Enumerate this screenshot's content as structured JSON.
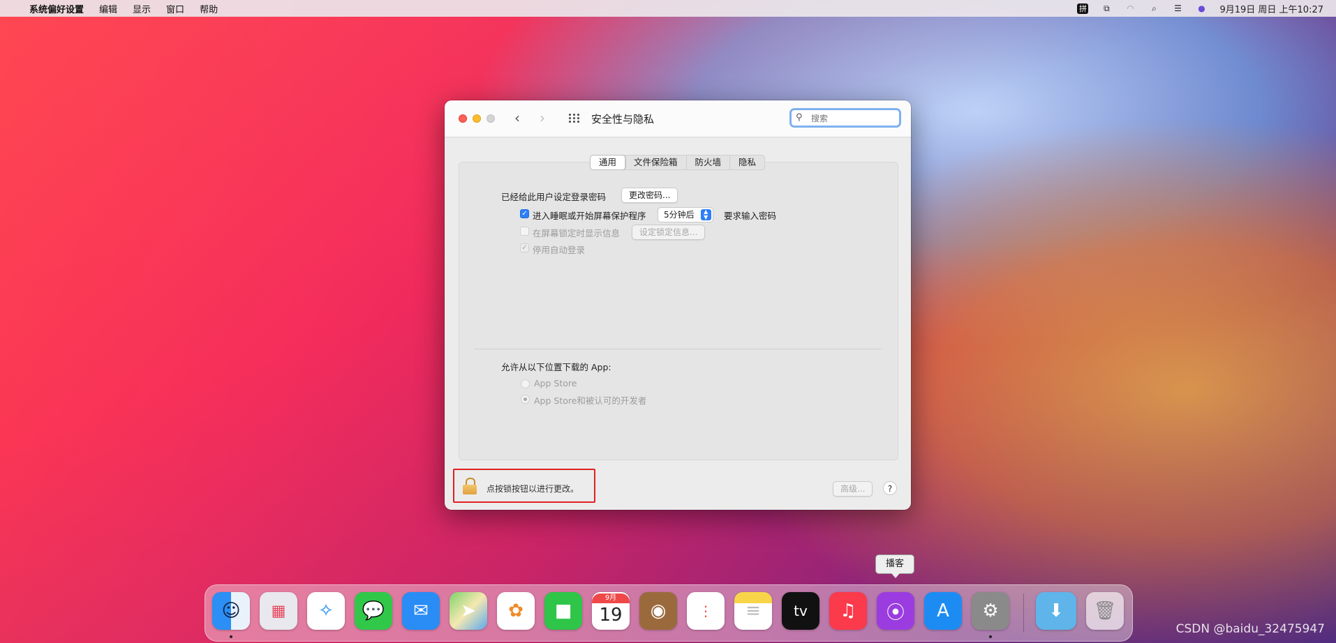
{
  "menubar": {
    "app": "系统偏好设置",
    "items": [
      "编辑",
      "显示",
      "窗口",
      "帮助"
    ],
    "ime": "拼",
    "datetime": "9月19日 周日 上午10:27"
  },
  "window": {
    "title": "安全性与隐私",
    "search_placeholder": "搜索",
    "tabs": [
      "通用",
      "文件保险箱",
      "防火墙",
      "隐私"
    ],
    "general": {
      "password_label": "已经给此用户设定登录密码",
      "change_password_btn": "更改密码...",
      "sleep_label": "进入睡眠或开始屏幕保护程序",
      "sleep_delay": "5分钟后",
      "require_pw_label": "要求输入密码",
      "show_message_label": "在屏幕锁定时显示信息",
      "set_lock_msg_btn": "设定锁定信息...",
      "disable_autologin_label": "停用自动登录",
      "allow_apps_label": "允许从以下位置下载的 App:",
      "opt_appstore": "App Store",
      "opt_appstore_dev": "App Store和被认可的开发者"
    },
    "lock_text": "点按锁按钮以进行更改。",
    "advanced_btn": "高级...",
    "help_btn": "?"
  },
  "dock": {
    "tooltip": "播客",
    "calendar_month": "9月",
    "calendar_day": "19",
    "tv_label": "tv"
  },
  "watermark": "CSDN @baidu_32475947"
}
